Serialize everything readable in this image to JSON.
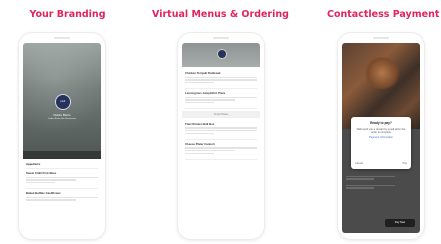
{
  "columns": [
    {
      "title": "Your Branding"
    },
    {
      "title": "Virtual Menus & Ordering"
    },
    {
      "title": "Contactless Payment"
    }
  ],
  "branding": {
    "logo_text": "prefr",
    "venue_name": "Dubini Bistro",
    "venue_sub": "Dubini Bistro Bar Restaurant",
    "section": "Appetizers",
    "items": [
      {
        "name": "Sweet Chilli Pork Bites"
      },
      {
        "name": "Baked Buffalo Cauliflower"
      }
    ]
  },
  "menu": {
    "items_top": [
      {
        "name": "Chicken Teriyaki Flatbread"
      },
      {
        "name": "Lemongrass Jumpinfish Pizza"
      }
    ],
    "divider": "Small Plates",
    "items_bottom": [
      {
        "name": "Thai Chicken Ball Box"
      },
      {
        "name": "Cheese Plater Cannoli"
      }
    ]
  },
  "payment": {
    "modal_title": "Ready to pay?",
    "modal_body": "Well send you a receipt by email when the order is complete",
    "modal_link": "Payment Information",
    "cancel": "Cancel",
    "ok": "Pay",
    "pay_button": "Pay Now"
  }
}
